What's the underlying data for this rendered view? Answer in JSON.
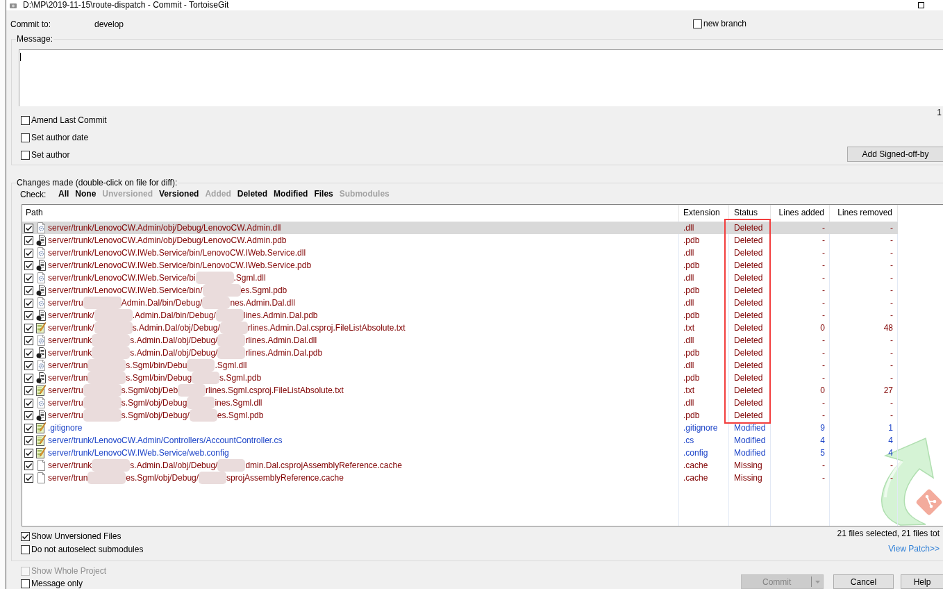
{
  "window": {
    "title": "D:\\MP\\2019-11-15\\route-dispatch - Commit - TortoiseGit"
  },
  "commit_to": {
    "label": "Commit to:",
    "branch": "develop",
    "new_branch": {
      "label": "new branch",
      "checked": false
    }
  },
  "message": {
    "label": "Message:",
    "counter": "1",
    "options": [
      {
        "label": "Amend Last Commit",
        "checked": false
      },
      {
        "label": "Set author date",
        "checked": false
      },
      {
        "label": "Set author",
        "checked": false
      }
    ],
    "signoff_button": "Add Signed-off-by"
  },
  "changes": {
    "label": "Changes made (double-click on file for diff):",
    "check_label": "Check:",
    "filters": [
      {
        "label": "All",
        "disabled": false
      },
      {
        "label": "None",
        "disabled": false
      },
      {
        "label": "Unversioned",
        "disabled": true
      },
      {
        "label": "Versioned",
        "disabled": false
      },
      {
        "label": "Added",
        "disabled": true
      },
      {
        "label": "Deleted",
        "disabled": false
      },
      {
        "label": "Modified",
        "disabled": false
      },
      {
        "label": "Files",
        "disabled": false
      },
      {
        "label": "Submodules",
        "disabled": true
      }
    ],
    "columns": [
      "Path",
      "Extension",
      "Status",
      "Lines added",
      "Lines removed"
    ],
    "row_groups": [
      {
        "highlighted": true,
        "rows": [
          {
            "path": [
              "server/trunk/LenovoCW.Admin/obj/Debug/LenovoCW.Admin.dll"
            ],
            "kind": "gear",
            "extension": ".dll",
            "status": "Deleted",
            "lines_added": "-",
            "lines_removed": "-",
            "color": "#800000",
            "checked": true,
            "selected": true
          },
          {
            "path": [
              "server/trunk/LenovoCW.Admin/obj/Debug/LenovoCW.Admin.pdb"
            ],
            "kind": "dot",
            "extension": ".pdb",
            "status": "Deleted",
            "lines_added": "-",
            "lines_removed": "-",
            "color": "#800000",
            "checked": true,
            "selected": false
          },
          {
            "path": [
              "server/trunk/LenovoCW.IWeb.Service/bin/LenovoCW.IWeb.Service.dll"
            ],
            "kind": "gear",
            "extension": ".dll",
            "status": "Deleted",
            "lines_added": "-",
            "lines_removed": "-",
            "color": "#800000",
            "checked": true,
            "selected": false
          },
          {
            "path": [
              "server/trunk/LenovoCW.IWeb.Service/bin/LenovoCW.IWeb.Service.pdb"
            ],
            "kind": "dot",
            "extension": ".pdb",
            "status": "Deleted",
            "lines_added": "-",
            "lines_removed": "-",
            "color": "#800000",
            "checked": true,
            "selected": false
          },
          {
            "path": [
              "server/trunk/LenovoCW.IWeb.Service/bi",
              ".Sgml.dll"
            ],
            "kind": "gear",
            "extension": ".dll",
            "status": "Deleted",
            "lines_added": "-",
            "lines_removed": "-",
            "color": "#800000",
            "checked": true,
            "selected": false
          },
          {
            "path": [
              "server/trunk/LenovoCW.IWeb.Service/bin/",
              "es.Sgml.pdb"
            ],
            "kind": "dot",
            "extension": ".pdb",
            "status": "Deleted",
            "lines_added": "-",
            "lines_removed": "-",
            "color": "#800000",
            "checked": true,
            "selected": false
          },
          {
            "path": [
              "server/tru",
              "Admin.Dal/bin/Debug/",
              "nes.Admin.Dal.dll"
            ],
            "kind": "gear",
            "extension": ".dll",
            "status": "Deleted",
            "lines_added": "-",
            "lines_removed": "-",
            "color": "#800000",
            "checked": true,
            "selected": false
          },
          {
            "path": [
              "server/trunk/",
              ".Admin.Dal/bin/Debug/",
              "lines.Admin.Dal.pdb"
            ],
            "kind": "dot",
            "extension": ".pdb",
            "status": "Deleted",
            "lines_added": "-",
            "lines_removed": "-",
            "color": "#800000",
            "checked": true,
            "selected": false
          },
          {
            "path": [
              "server/trunk/",
              "s.Admin.Dal/obj/Debug/",
              "rlines.Admin.Dal.csproj.FileListAbsolute.txt"
            ],
            "kind": "pencil",
            "extension": ".txt",
            "status": "Deleted",
            "lines_added": "0",
            "lines_removed": "48",
            "color": "#800000",
            "checked": true,
            "selected": false
          },
          {
            "path": [
              "server/trunk",
              "s.Admin.Dal/obj/Debug/",
              "rlines.Admin.Dal.dll"
            ],
            "kind": "gear",
            "extension": ".dll",
            "status": "Deleted",
            "lines_added": "-",
            "lines_removed": "-",
            "color": "#800000",
            "checked": true,
            "selected": false
          },
          {
            "path": [
              "server/trunk",
              "s.Admin.Dal/obj/Debug/",
              "rlines.Admin.Dal.pdb"
            ],
            "kind": "dot",
            "extension": ".pdb",
            "status": "Deleted",
            "lines_added": "-",
            "lines_removed": "-",
            "color": "#800000",
            "checked": true,
            "selected": false
          },
          {
            "path": [
              "server/trun",
              "s.Sgml/bin/Debu",
              ".Sgml.dll"
            ],
            "kind": "gear",
            "extension": ".dll",
            "status": "Deleted",
            "lines_added": "-",
            "lines_removed": "-",
            "color": "#800000",
            "checked": true,
            "selected": false
          },
          {
            "path": [
              "server/trun",
              "s.Sgml/bin/Debug",
              "s.Sgml.pdb"
            ],
            "kind": "dot",
            "extension": ".pdb",
            "status": "Deleted",
            "lines_added": "-",
            "lines_removed": "-",
            "color": "#800000",
            "checked": true,
            "selected": false
          },
          {
            "path": [
              "server/tru",
              "s.Sgml/obj/Deb",
              "rlines.Sgml.csproj.FileListAbsolute.txt"
            ],
            "kind": "pencil",
            "extension": ".txt",
            "status": "Deleted",
            "lines_added": "0",
            "lines_removed": "27",
            "color": "#800000",
            "checked": true,
            "selected": false
          },
          {
            "path": [
              "server/tru",
              "s.Sgml/obj/Debug",
              "ines.Sgml.dll"
            ],
            "kind": "gear",
            "extension": ".dll",
            "status": "Deleted",
            "lines_added": "-",
            "lines_removed": "-",
            "color": "#800000",
            "checked": true,
            "selected": false
          },
          {
            "path": [
              "server/tru",
              "s.Sgml/obj/Debug/",
              "es.Sgml.pdb"
            ],
            "kind": "dot",
            "extension": ".pdb",
            "status": "Deleted",
            "lines_added": "-",
            "lines_removed": "-",
            "color": "#800000",
            "checked": true,
            "selected": false
          }
        ]
      },
      {
        "highlighted": false,
        "rows": [
          {
            "path": [
              ".gitignore"
            ],
            "kind": "pencil",
            "extension": ".gitignore",
            "status": "Modified",
            "lines_added": "9",
            "lines_removed": "1",
            "color": "#1c44c8",
            "checked": true,
            "selected": false
          },
          {
            "path": [
              "server/trunk/LenovoCW.Admin/Controllers/AccountController.cs"
            ],
            "kind": "pencil",
            "extension": ".cs",
            "status": "Modified",
            "lines_added": "4",
            "lines_removed": "4",
            "color": "#1c44c8",
            "checked": true,
            "selected": false
          },
          {
            "path": [
              "server/trunk/LenovoCW.IWeb.Service/web.config"
            ],
            "kind": "pencil",
            "extension": ".config",
            "status": "Modified",
            "lines_added": "5",
            "lines_removed": "4",
            "color": "#1c44c8",
            "checked": true,
            "selected": false
          },
          {
            "path": [
              "server/trunk",
              "s.Admin.Dal/obj/Debug/",
              "dmin.Dal.csprojAssemblyReference.cache"
            ],
            "kind": "blank",
            "extension": ".cache",
            "status": "Missing",
            "lines_added": "-",
            "lines_removed": "-",
            "color": "#800000",
            "checked": true,
            "selected": false
          },
          {
            "path": [
              "server/trun",
              "es.Sgml/obj/Debug/",
              "sprojAssemblyReference.cache"
            ],
            "kind": "blank",
            "extension": ".cache",
            "status": "Missing",
            "lines_added": "-",
            "lines_removed": "-",
            "color": "#800000",
            "checked": true,
            "selected": false
          }
        ]
      }
    ],
    "options": [
      {
        "label": "Show Unversioned Files",
        "checked": true
      },
      {
        "label": "Do not autoselect submodules",
        "checked": false
      }
    ],
    "summary": "21 files selected, 21 files tot",
    "view_patch": "View Patch>>"
  },
  "bottom_options": [
    {
      "label": "Show Whole Project",
      "checked": false,
      "disabled": true
    },
    {
      "label": "Message only",
      "checked": false,
      "disabled": false
    }
  ],
  "buttons": [
    {
      "label": "Commit",
      "kind": "split",
      "disabled": true
    },
    {
      "label": "Cancel",
      "kind": "plain",
      "disabled": false
    },
    {
      "label": "Help",
      "kind": "plain",
      "disabled": false
    }
  ]
}
